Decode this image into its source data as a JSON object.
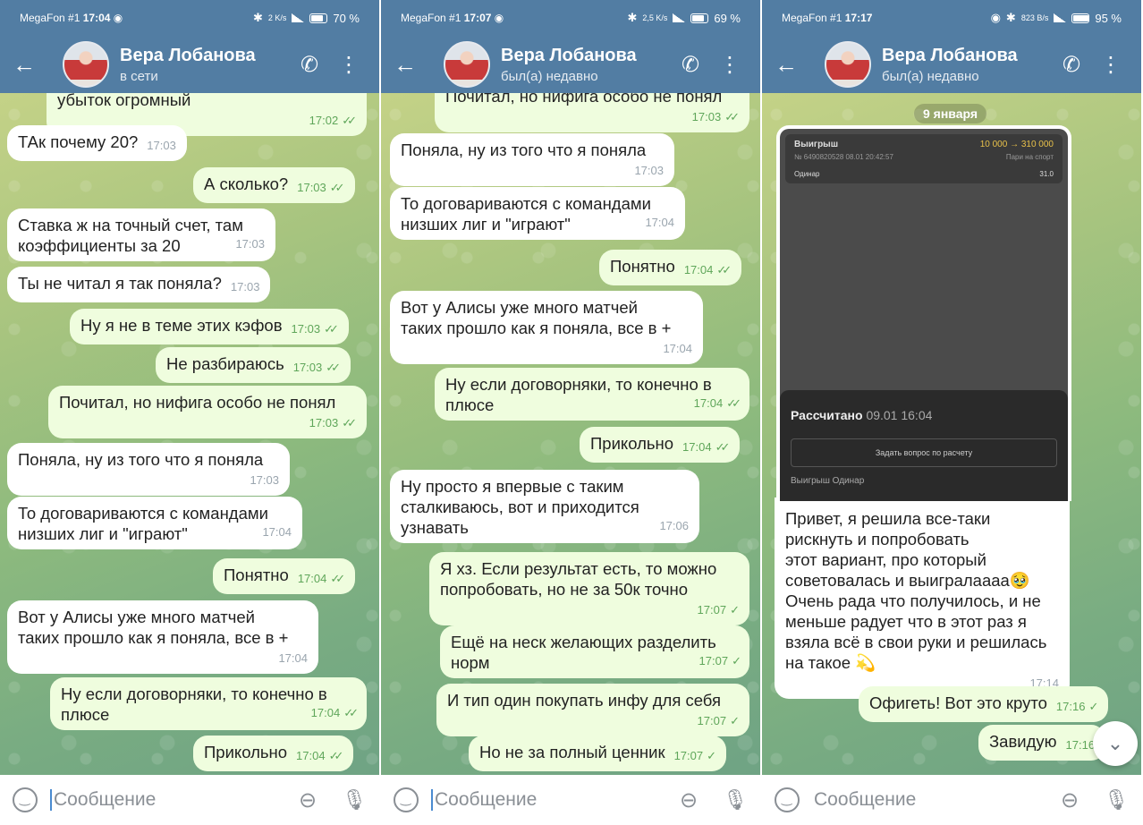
{
  "panels": [
    {
      "status": {
        "carrier": "MegaFon #1",
        "time": "17:04",
        "speed": "2 K/s",
        "battery": "70 %"
      },
      "contact": {
        "name": "Вера Лобанова",
        "presence": "в сети"
      },
      "input_placeholder": "Сообщение",
      "messages": [
        {
          "dir": "out",
          "text": "убыток огромный",
          "time": "17:02"
        },
        {
          "dir": "in",
          "text": "ТАк почему 20?",
          "time": "17:03"
        },
        {
          "dir": "out",
          "text": "А сколько?",
          "time": "17:03"
        },
        {
          "dir": "in",
          "text": "Ставка ж на точный счет, там\nкоэффициенты за 20",
          "time": "17:03"
        },
        {
          "dir": "in",
          "text": "Ты не читал я так поняла?",
          "time": "17:03"
        },
        {
          "dir": "out",
          "text": "Ну я не в теме этих кэфов",
          "time": "17:03"
        },
        {
          "dir": "out",
          "text": "Не разбираюсь",
          "time": "17:03"
        },
        {
          "dir": "out",
          "text": "Почитал, но нифига особо не понял",
          "time": "17:03"
        },
        {
          "dir": "in",
          "text": "Поняла, ну из того что я поняла",
          "time": "17:03"
        },
        {
          "dir": "in",
          "text": "То договариваются с командами\nнизших лиг и \"играют\"",
          "time": "17:04"
        },
        {
          "dir": "out",
          "text": "Понятно",
          "time": "17:04"
        },
        {
          "dir": "in",
          "text": "Вот у Алисы уже много матчей\nтаких прошло как я поняла, все в +",
          "time": "17:04"
        },
        {
          "dir": "out",
          "text": "Ну если договорняки, то конечно в\nплюсе",
          "time": "17:04"
        },
        {
          "dir": "out",
          "text": "Прикольно",
          "time": "17:04"
        }
      ]
    },
    {
      "status": {
        "carrier": "MegaFon #1",
        "time": "17:07",
        "speed": "2,5 K/s",
        "battery": "69 %"
      },
      "contact": {
        "name": "Вера Лобанова",
        "presence": "был(а) недавно"
      },
      "input_placeholder": "Сообщение",
      "messages": [
        {
          "dir": "out",
          "text": "Почитал, но нифига особо не понял",
          "time": "17:03"
        },
        {
          "dir": "in",
          "text": "Поняла, ну из того что я поняла",
          "time": "17:03"
        },
        {
          "dir": "in",
          "text": "То договариваются с командами\nнизших лиг и \"играют\"",
          "time": "17:04"
        },
        {
          "dir": "out",
          "text": "Понятно",
          "time": "17:04"
        },
        {
          "dir": "in",
          "text": "Вот у Алисы уже много матчей\nтаких прошло как я поняла, все в +",
          "time": "17:04"
        },
        {
          "dir": "out",
          "text": "Ну если договорняки, то конечно в\nплюсе",
          "time": "17:04"
        },
        {
          "dir": "out",
          "text": "Прикольно",
          "time": "17:04"
        },
        {
          "dir": "in",
          "text": "Ну просто я впервые с таким\nсталкиваюсь, вот и приходится\nузнавать",
          "time": "17:06"
        },
        {
          "dir": "out",
          "text": "Я хз. Если результат есть, то можно\nпопробовать, но не за 50к точно",
          "time": "17:07"
        },
        {
          "dir": "out",
          "text": "Ещё на неск желающих разделить\nнорм",
          "time": "17:07"
        },
        {
          "dir": "out",
          "text": "И тип один покупать инфу для себя",
          "time": "17:07"
        },
        {
          "dir": "out",
          "text": "Но не за полный ценник",
          "time": "17:07"
        }
      ]
    },
    {
      "status": {
        "carrier": "MegaFon #1",
        "time": "17:17",
        "speed": "823 B/s",
        "battery": "95 %"
      },
      "contact": {
        "name": "Вера Лобанова",
        "presence": "был(а) недавно"
      },
      "input_placeholder": "Сообщение",
      "date_label": "9 января",
      "screenshot": {
        "title": "Выигрыш",
        "amount": "10 000 → 310 000",
        "ticket": "№ 6490820528  08.01 20:42:57",
        "sport": "Пари на спорт",
        "bet_type": "Одинар",
        "coef": "31.0",
        "settled": "Рассчитано",
        "settled_time": "09.01 16:04",
        "ask_button": "Задать вопрос по расчету",
        "footer": "Выигрыш Одинар"
      },
      "messages": [
        {
          "dir": "in",
          "text": "Привет, я решила все-таки\nрискнуть и попробовать\nэтот вариант, про который\nсоветовалась и выигралаааа🥹\nОчень рада что получилось, и не\nменьше радует что в этот раз я\nвзяла всё в свои руки и решилась\nна такое 💫",
          "time": "17:14"
        },
        {
          "dir": "out",
          "text": "Офигеть! Вот это круто",
          "time": "17:16"
        },
        {
          "dir": "out",
          "text": "Завидую",
          "time": "17:16"
        }
      ]
    }
  ]
}
